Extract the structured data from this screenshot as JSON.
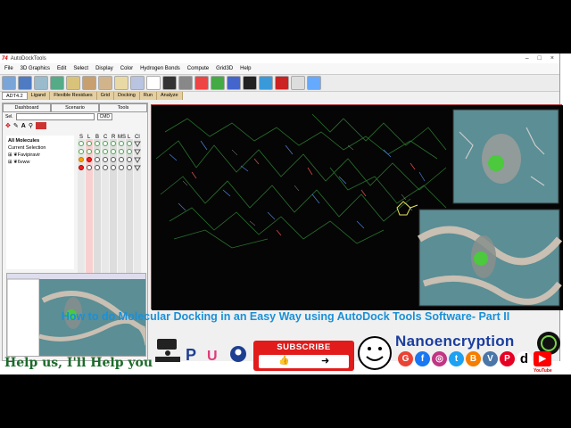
{
  "window": {
    "title": "AutoDockTools",
    "logo": "74"
  },
  "menu": [
    "File",
    "3D Graphics",
    "Edit",
    "Select",
    "Display",
    "Color",
    "Hydrogen Bonds",
    "Compute",
    "Grid3D",
    "Help"
  ],
  "tabs": [
    "ADT4.2",
    "Ligand",
    "Flexible Residues",
    "Grid",
    "Docking",
    "Run",
    "Analyze"
  ],
  "panel": {
    "subtabs": [
      "Dashboard",
      "Scenario",
      "Tools"
    ],
    "sel_label": "Sel.",
    "cmd_label": "CMD",
    "tree": [
      "All Molecules",
      "Current Selection",
      "Favipiravir",
      "6vww"
    ],
    "column_headers": [
      "S",
      "L",
      "B",
      "C",
      "R",
      "MS",
      "L",
      "Cl"
    ]
  },
  "caption": "How to do Molecular Docking in an Easy Way using AutoDock Tools Software- Part II",
  "footer": {
    "help_text": "Help us, I'll Help you",
    "subscribe": "SUBSCRIBE",
    "brand": "Nanoencryption",
    "youtube_label": "YouTube"
  },
  "colors": {
    "caption": "#1a90d8",
    "help": "#1b6b2a",
    "subscribe": "#e21b1b",
    "brand": "#1b3e9e"
  },
  "icons": [
    "gear-icon",
    "pencil-icon",
    "arrow-icon",
    "smiley-icon",
    "google-icon",
    "facebook-icon",
    "instagram-icon",
    "twitter-icon",
    "blogger-icon",
    "vk-icon",
    "pinterest-icon",
    "dailymotion-icon",
    "youtube-icon",
    "paypal-icon",
    "upwork-icon",
    "patreon-icon"
  ]
}
